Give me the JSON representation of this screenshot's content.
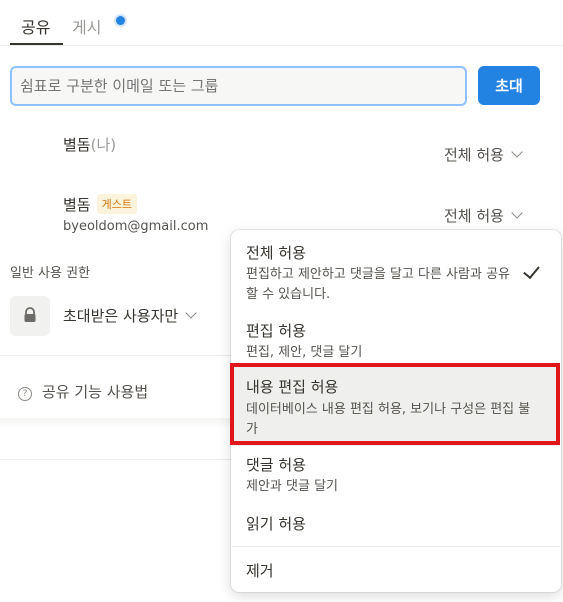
{
  "tabs": {
    "share": "공유",
    "publish": "게시"
  },
  "invite": {
    "placeholder": "쉼표로 구분한 이메일 또는 그룹",
    "button_label": "초대"
  },
  "members": [
    {
      "name": "별돔",
      "suffix": "(나)",
      "permission": "전체 허용"
    },
    {
      "name": "별돔",
      "badge": "게스트",
      "email": "byeoldom@gmail.com",
      "permission": "전체 허용"
    }
  ],
  "general_access": {
    "label": "일반 사용 권한",
    "value": "초대받은 사용자만"
  },
  "help": {
    "label": "공유 기능 사용법"
  },
  "permission_menu": {
    "items": [
      {
        "title": "전체 허용",
        "description": "편집하고 제안하고 댓글을 달고 다른 사람과 공유할 수 있습니다.",
        "checked": true
      },
      {
        "title": "편집 허용",
        "description": "편집, 제안, 댓글 달기"
      },
      {
        "title": "내용 편집 허용",
        "description": "데이터베이스 내용 편집 허용, 보기나 구성은 편집 불가",
        "highlighted": true
      },
      {
        "title": "댓글 허용",
        "description": "제안과 댓글 달기"
      },
      {
        "title": "읽기 허용"
      },
      {
        "title": "제거"
      }
    ]
  },
  "colors": {
    "accent": "#2383e2",
    "highlight_border": "#e0161b",
    "guest_badge_text": "#d9730d"
  }
}
